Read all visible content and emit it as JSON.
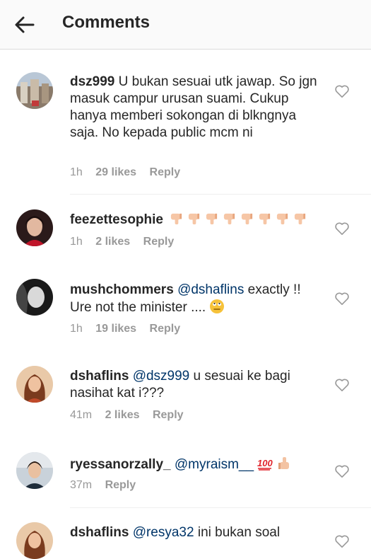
{
  "header": {
    "title": "Comments"
  },
  "comments": [
    {
      "user": "dsz999",
      "text": "U bukan sesuai utk jawap. So jgn masuk campur urusan suami. Cukup hanya memberi sokongan di blkngnya saja. No kepada public mcm ni",
      "time": "1h",
      "likes": "29 likes",
      "reply": "Reply"
    },
    {
      "user": "feezettesophie",
      "text": "",
      "time": "1h",
      "likes": "2 likes",
      "reply": "Reply"
    },
    {
      "user": "mushchommers",
      "mention": "@dshaflins",
      "text": "exactly !! Ure not the minister ....",
      "time": "1h",
      "likes": "19 likes",
      "reply": "Reply"
    },
    {
      "user": "dshaflins",
      "mention": "@dsz999",
      "text": "u sesuai ke bagi nasihat kat i???",
      "time": "41m",
      "likes": "2 likes",
      "reply": "Reply"
    },
    {
      "user": "ryessanorzally_",
      "mention": "@myraism__",
      "text": "",
      "time": "37m",
      "reply": "Reply"
    },
    {
      "user": "dshaflins",
      "mention": "@resya32",
      "text": "ini bukan soal"
    }
  ],
  "colors": {
    "mention": "#003569",
    "meta": "#999999",
    "text": "#262626"
  }
}
